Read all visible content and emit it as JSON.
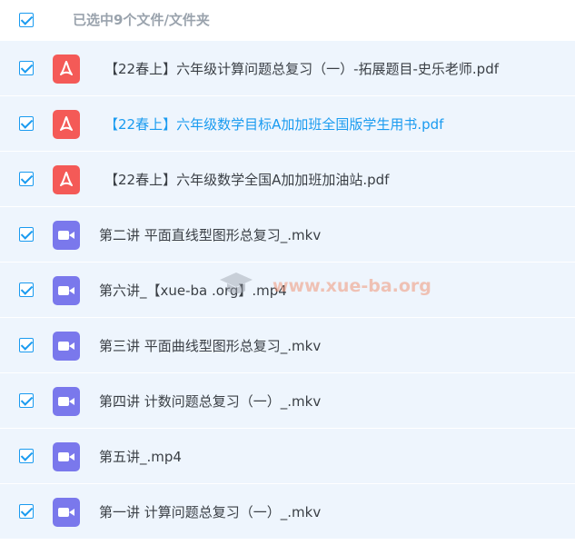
{
  "header": {
    "title": "已选中9个文件/文件夹"
  },
  "files": [
    {
      "type": "pdf",
      "name": "【22春上】六年级计算问题总复习（一）-拓展题目-史乐老师.pdf",
      "highlight": false
    },
    {
      "type": "pdf",
      "name": "【22春上】六年级数学目标A加加班全国版学生用书.pdf",
      "highlight": true
    },
    {
      "type": "pdf",
      "name": "【22春上】六年级数学全国A加加班加油站.pdf",
      "highlight": false
    },
    {
      "type": "video",
      "name": "第二讲 平面直线型图形总复习_.mkv",
      "highlight": false
    },
    {
      "type": "video",
      "name": "第六讲_【xue-ba .org】.mp4",
      "highlight": false
    },
    {
      "type": "video",
      "name": "第三讲 平面曲线型图形总复习_.mkv",
      "highlight": false
    },
    {
      "type": "video",
      "name": "第四讲 计数问题总复习（一）_.mkv",
      "highlight": false
    },
    {
      "type": "video",
      "name": "第五讲_.mp4",
      "highlight": false
    },
    {
      "type": "video",
      "name": "第一讲 计算问题总复习（一）_.mkv",
      "highlight": false
    }
  ],
  "watermark": {
    "text": "www.xue-ba.org"
  },
  "colors": {
    "accent": "#1a9bf0",
    "row_bg": "#eef5fd",
    "pdf": "#f45a57",
    "video": "#7a78ec"
  },
  "icons": {
    "pdf": "pdf-file-icon",
    "video": "video-file-icon",
    "check": "checkbox-checked-icon"
  }
}
